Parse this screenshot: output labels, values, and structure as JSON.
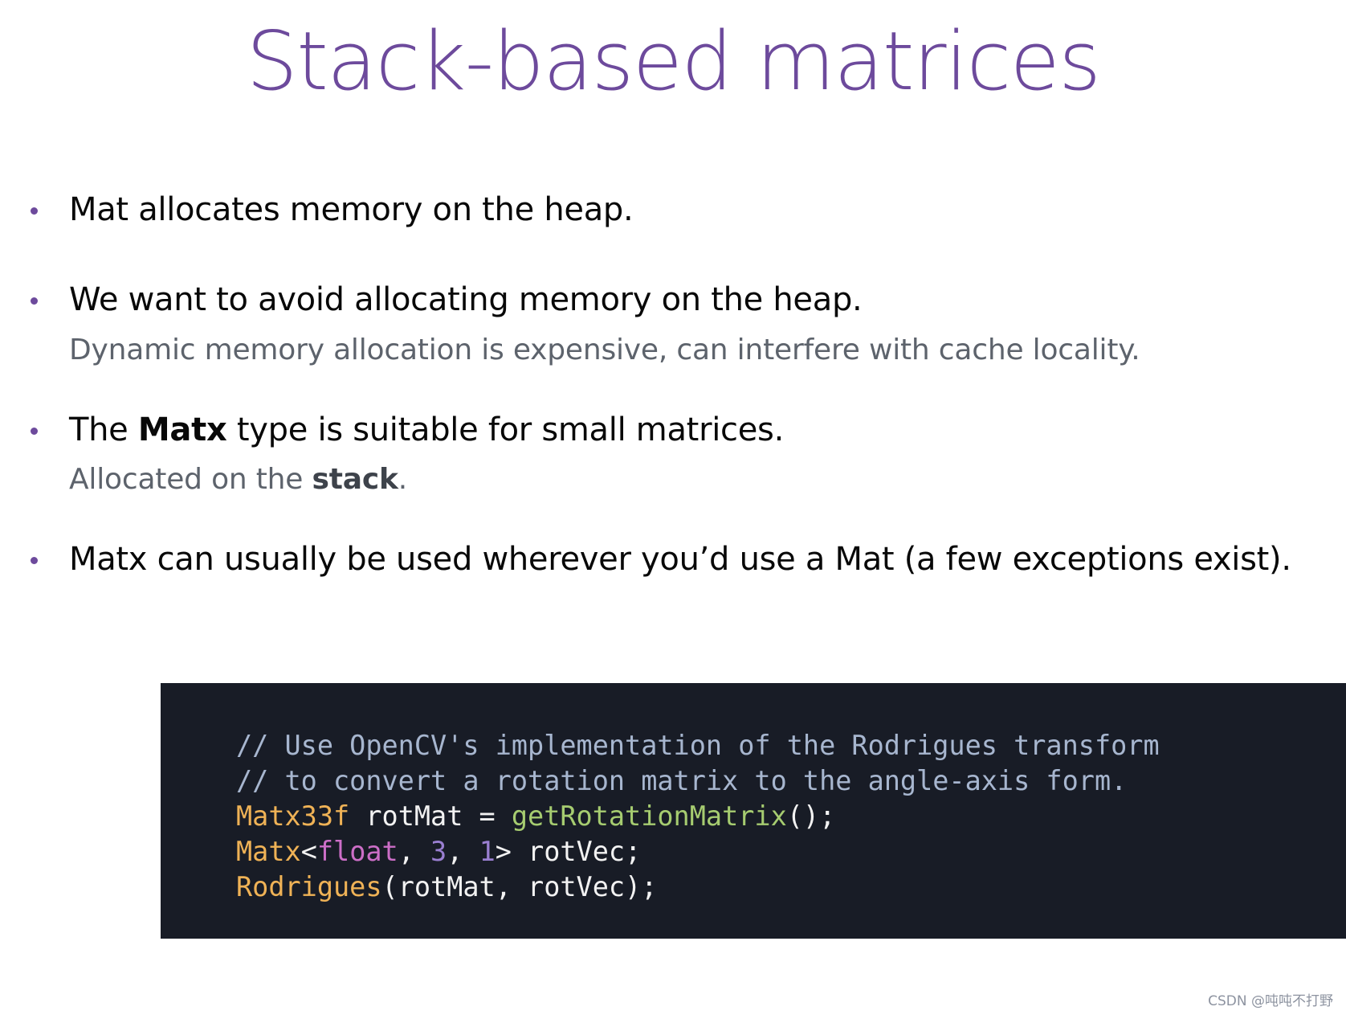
{
  "slide": {
    "title": "Stack-based matrices",
    "title_color": "#6d4a9c",
    "background_color": "#ffffff"
  },
  "bullets": [
    {
      "main": "Mat allocates memory on the heap.",
      "sub": ""
    },
    {
      "main": "We want to avoid allocating memory on the heap.",
      "sub": "Dynamic memory allocation is expensive, can interfere with cache locality."
    },
    {
      "main_pre": "The ",
      "main_bold": "Matx",
      "main_post": " type is suitable for small matrices.",
      "sub_pre": "Allocated on the ",
      "sub_bold": "stack",
      "sub_post": "."
    },
    {
      "main": "Matx can usually be used wherever you’d use a Mat (a few exceptions exist).",
      "sub": ""
    }
  ],
  "code": {
    "background_color": "#181c26",
    "colors": {
      "comment": "#a7b6cf",
      "type": "#efb256",
      "function": "#a6cc70",
      "keyword": "#cc6ec7",
      "number": "#9a7fd1",
      "plain": "#f2f2f2"
    },
    "lines": [
      {
        "tokens": [
          {
            "t": "// Use OpenCV's implementation of the Rodrigues transform",
            "c": "comment"
          }
        ]
      },
      {
        "tokens": [
          {
            "t": "// to convert a rotation matrix to the angle-axis form.",
            "c": "comment"
          }
        ]
      },
      {
        "tokens": [
          {
            "t": "Matx33f",
            "c": "type"
          },
          {
            "t": " rotMat = ",
            "c": "plain"
          },
          {
            "t": "getRotationMatrix",
            "c": "function"
          },
          {
            "t": "();",
            "c": "plain"
          }
        ]
      },
      {
        "tokens": [
          {
            "t": "Matx",
            "c": "type"
          },
          {
            "t": "<",
            "c": "plain"
          },
          {
            "t": "float",
            "c": "keyword"
          },
          {
            "t": ", ",
            "c": "plain"
          },
          {
            "t": "3",
            "c": "number"
          },
          {
            "t": ", ",
            "c": "plain"
          },
          {
            "t": "1",
            "c": "number"
          },
          {
            "t": "> rotVec;",
            "c": "plain"
          }
        ]
      },
      {
        "tokens": [
          {
            "t": "Rodrigues",
            "c": "type"
          },
          {
            "t": "(rotMat, rotVec);",
            "c": "plain"
          }
        ]
      }
    ]
  },
  "watermark": {
    "text": "CSDN @吨吨不打野"
  }
}
